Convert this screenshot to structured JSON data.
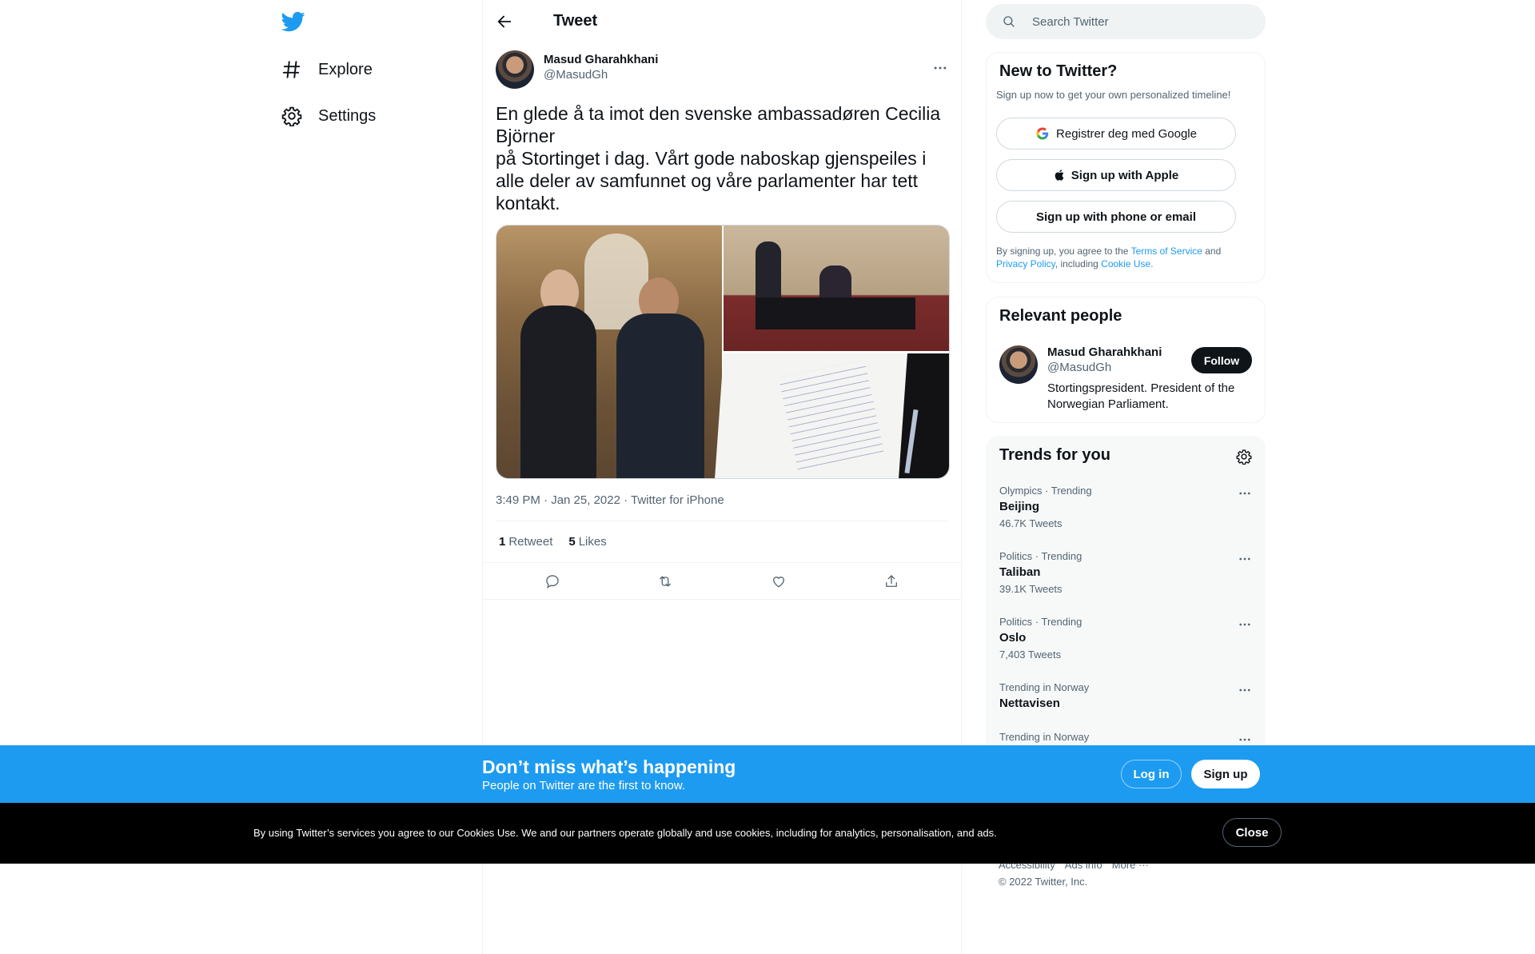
{
  "nav": {
    "explore_label": "Explore",
    "settings_label": "Settings"
  },
  "header": {
    "title": "Tweet"
  },
  "tweet": {
    "author_name": "Masud Gharahkhani",
    "author_handle": "@MasudGh",
    "text": "En glede å ta imot den svenske ambassadøren Cecilia Björner\npå Stortinget i dag. Vårt gode naboskap gjenspeiles i alle deler av samfunnet og våre parlamenter har tett kontakt.",
    "timestamp": "3:49 PM · Jan 25, 2022 · Twitter for iPhone",
    "retweet_count": "1",
    "retweet_label": "Retweet",
    "like_count": "5",
    "like_label": "Likes"
  },
  "search": {
    "placeholder": "Search Twitter"
  },
  "signup": {
    "title": "New to Twitter?",
    "subtitle": "Sign up now to get your own personalized timeline!",
    "google_label": "Registrer deg med Google",
    "apple_label": "Sign up with Apple",
    "phone_label": "Sign up with phone or email",
    "legal_1": "By signing up, you agree to the ",
    "terms": "Terms of Service",
    "legal_2": " and ",
    "privacy": "Privacy Policy",
    "legal_3": ", including ",
    "cookie": "Cookie Use."
  },
  "relevant": {
    "title": "Relevant people",
    "name": "Masud Gharahkhani",
    "handle": "@MasudGh",
    "bio": "Stortingspresident. President of the Norwegian Parliament.",
    "follow_label": "Follow"
  },
  "trends": {
    "title": "Trends for you",
    "items": [
      {
        "context": "Olympics · Trending",
        "name": "Beijing",
        "count": "46.7K Tweets"
      },
      {
        "context": "Politics · Trending",
        "name": "Taliban",
        "count": "39.1K Tweets"
      },
      {
        "context": "Politics · Trending",
        "name": "Oslo",
        "count": "7,403 Tweets"
      },
      {
        "context": "Trending in Norway",
        "name": "Nettavisen",
        "count": ""
      },
      {
        "context": "Trending in Norway",
        "name": "",
        "count": ""
      }
    ]
  },
  "footer": {
    "accessibility": "Accessibility",
    "ads_info": "Ads info",
    "more": "More ···",
    "copyright": "© 2022 Twitter, Inc."
  },
  "bottom_bar": {
    "title": "Don’t miss what’s happening",
    "subtitle": "People on Twitter are the first to know.",
    "login_label": "Log in",
    "signup_label": "Sign up"
  },
  "cookie_bar": {
    "text": "By using Twitter’s services you agree to our Cookies Use. We and our partners operate globally and use cookies, including for analytics, personalisation, and ads.",
    "close_label": "Close"
  },
  "colors": {
    "brand": "#1d9bf0",
    "text": "#0f1419",
    "muted": "#536471"
  }
}
